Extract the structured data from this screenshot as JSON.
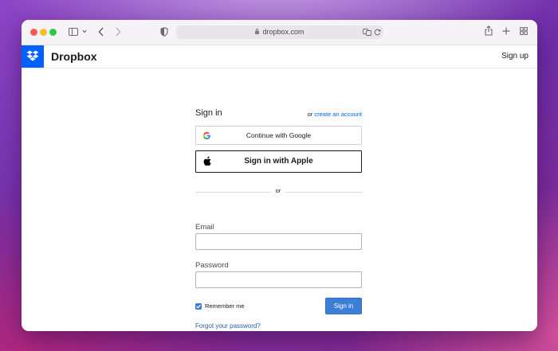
{
  "browser": {
    "url": "dropbox.com",
    "icons": [
      "sidebar-icon",
      "chevron-down-icon",
      "back-icon",
      "forward-icon",
      "shield-icon",
      "lock-icon",
      "translate-icon",
      "reload-icon",
      "share-icon",
      "new-tab-icon",
      "tab-overview-icon"
    ]
  },
  "site": {
    "brand": "Dropbox",
    "signup_label": "Sign up",
    "brand_color": "#0061fe"
  },
  "form": {
    "title": "Sign in",
    "create_prefix": "or",
    "create_link": "create an account",
    "google_label": "Continue with Google",
    "apple_label": "Sign in with Apple",
    "or_label": "or",
    "email_label": "Email",
    "email_value": "",
    "password_label": "Password",
    "password_value": "",
    "remember_label": "Remember me",
    "remember_checked": true,
    "signin_label": "Sign in",
    "forgot_label": "Forgot your password?",
    "accent_color": "#3d7fd6"
  }
}
